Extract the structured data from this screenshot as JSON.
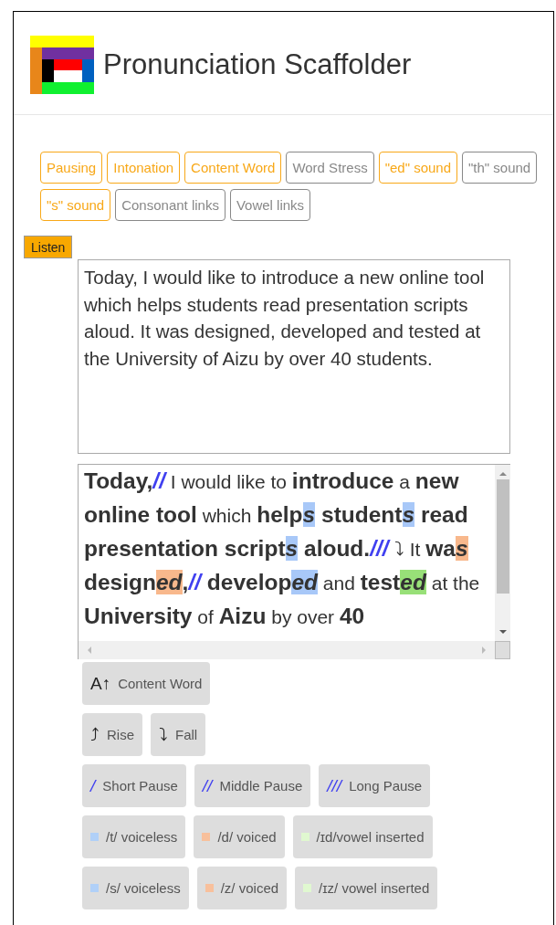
{
  "header": {
    "title": "Pronunciation Scaffolder"
  },
  "toggles": [
    {
      "label": "Pausing",
      "selected": true
    },
    {
      "label": "Intonation",
      "selected": true
    },
    {
      "label": "Content Word",
      "selected": true
    },
    {
      "label": "Word Stress",
      "selected": false
    },
    {
      "label": "\"ed\" sound",
      "selected": true
    },
    {
      "label": "\"th\" sound",
      "selected": false
    },
    {
      "label": "\"s\" sound",
      "selected": true
    },
    {
      "label": "Consonant links",
      "selected": false
    },
    {
      "label": "Vowel links",
      "selected": false
    }
  ],
  "listen_button": "Listen",
  "script_input": {
    "value": "Today, I would like to introduce a new online tool which helps students read presentation scripts aloud. It was designed, developed and tested at the University of Aizu by over 40 students."
  },
  "annotated_text": [
    {
      "kind": "content",
      "text": "Today,"
    },
    {
      "kind": "pause",
      "text": "//"
    },
    {
      "kind": "plain",
      "text": " I would like to "
    },
    {
      "kind": "content",
      "text": "introduce"
    },
    {
      "kind": "plain",
      "text": " a "
    },
    {
      "kind": "content",
      "text": "new online tool"
    },
    {
      "kind": "plain",
      "text": " which "
    },
    {
      "kind": "content",
      "text": "help"
    },
    {
      "kind": "ending",
      "text": "s",
      "color": "#a8c8f8"
    },
    {
      "kind": "content",
      "text": " student"
    },
    {
      "kind": "ending",
      "text": "s",
      "color": "#a8c8f8"
    },
    {
      "kind": "content",
      "text": " read presentation script"
    },
    {
      "kind": "ending",
      "text": "s",
      "color": "#a8c8f8"
    },
    {
      "kind": "content",
      "text": " aloud."
    },
    {
      "kind": "pause",
      "text": "///"
    },
    {
      "kind": "intonation",
      "text": "⤵"
    },
    {
      "kind": "plain",
      "text": " It "
    },
    {
      "kind": "content",
      "text": "wa"
    },
    {
      "kind": "ending",
      "text": "s",
      "color": "#f8b88c"
    },
    {
      "kind": "content",
      "text": " design"
    },
    {
      "kind": "ending",
      "text": "ed",
      "color": "#f8b88c"
    },
    {
      "kind": "content",
      "text": ","
    },
    {
      "kind": "pause",
      "text": "//"
    },
    {
      "kind": "content",
      "text": " develop"
    },
    {
      "kind": "ending",
      "text": "ed",
      "color": "#a8c8f8"
    },
    {
      "kind": "plain",
      "text": " and "
    },
    {
      "kind": "content",
      "text": "test"
    },
    {
      "kind": "ending",
      "text": "ed",
      "color": "#98e078"
    },
    {
      "kind": "plain",
      "text": " at the "
    },
    {
      "kind": "content",
      "text": "University"
    },
    {
      "kind": "plain",
      "text": " of "
    },
    {
      "kind": "content",
      "text": "Aizu"
    },
    {
      "kind": "plain",
      "text": " by over "
    },
    {
      "kind": "content",
      "text": "40"
    }
  ],
  "legend_rows": [
    [
      {
        "kind": "symbol",
        "symbol": "A↑",
        "label": "Content Word"
      }
    ],
    [
      {
        "kind": "symbol",
        "symbol": "⤴",
        "label": "Rise"
      },
      {
        "kind": "symbol",
        "symbol": "⤵",
        "label": "Fall"
      }
    ],
    [
      {
        "kind": "pause",
        "symbol": "/",
        "label": "Short Pause"
      },
      {
        "kind": "pause",
        "symbol": "//",
        "label": "Middle Pause"
      },
      {
        "kind": "pause",
        "symbol": "///",
        "label": "Long Pause"
      }
    ],
    [
      {
        "kind": "swatch",
        "color": "#b0d0f8",
        "label": "/t/ voiceless"
      },
      {
        "kind": "swatch",
        "color": "#f8c09c",
        "label": "/d/ voiced"
      },
      {
        "kind": "swatch",
        "color": "#e0f8d0",
        "label": "/ɪd/vowel inserted"
      }
    ],
    [
      {
        "kind": "swatch",
        "color": "#b0d0f8",
        "label": "/s/ voiceless"
      },
      {
        "kind": "swatch",
        "color": "#f8c09c",
        "label": "/z/ voiced"
      },
      {
        "kind": "swatch",
        "color": "#e0f8d0",
        "label": "/ɪz/ vowel inserted"
      }
    ]
  ]
}
